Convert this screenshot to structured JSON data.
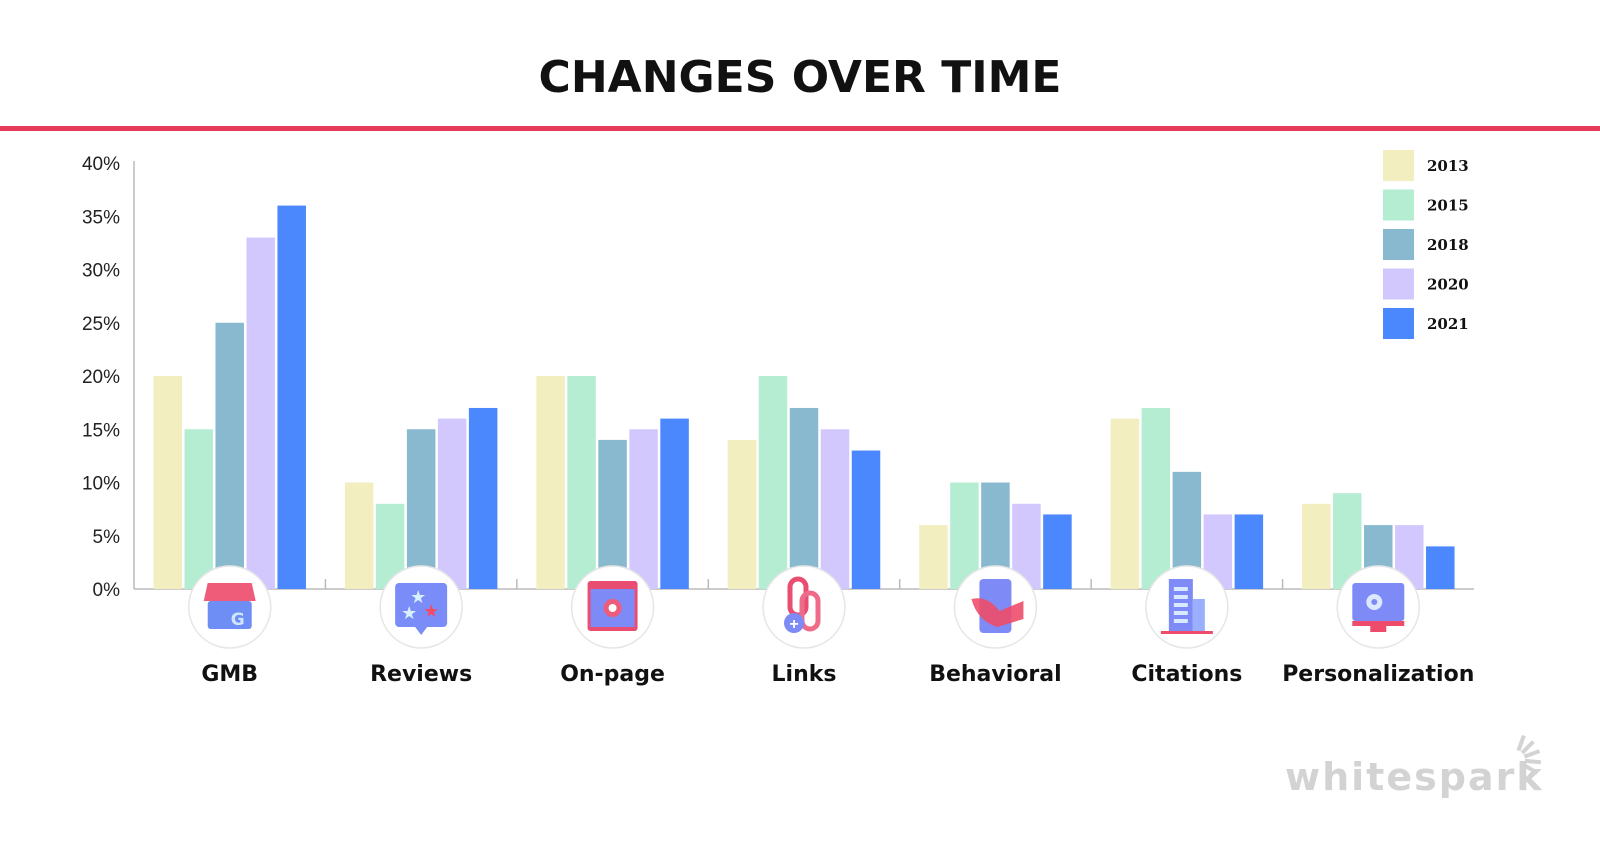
{
  "chart_data": {
    "type": "bar",
    "title": "CHANGES OVER TIME",
    "xlabel": "",
    "ylabel": "",
    "ylim": [
      0,
      40
    ],
    "yticks": [
      "0%",
      "5%",
      "10%",
      "15%",
      "20%",
      "25%",
      "30%",
      "35%",
      "40%"
    ],
    "ytick_values": [
      0,
      5,
      10,
      15,
      20,
      25,
      30,
      35,
      40
    ],
    "grid": false,
    "legend_position": "top-right",
    "categories": [
      "GMB",
      "Reviews",
      "On-page",
      "Links",
      "Behavioral",
      "Citations",
      "Personalization"
    ],
    "category_icons": [
      "storefront-icon",
      "star-review-icon",
      "webpage-gear-icon",
      "link-chain-icon",
      "smartphone-hand-icon",
      "building-icon",
      "monitor-gear-icon"
    ],
    "series": [
      {
        "name": "2013",
        "color": "#f3eec0",
        "values": [
          20,
          10,
          20,
          14,
          6,
          16,
          8
        ]
      },
      {
        "name": "2015",
        "color": "#b5edd3",
        "values": [
          15,
          8,
          20,
          20,
          10,
          17,
          9
        ]
      },
      {
        "name": "2018",
        "color": "#89b9cf",
        "values": [
          25,
          15,
          14,
          17,
          10,
          11,
          6
        ]
      },
      {
        "name": "2020",
        "color": "#d3c8fd",
        "values": [
          33,
          16,
          15,
          15,
          8,
          7,
          6
        ]
      },
      {
        "name": "2021",
        "color": "#4b87fd",
        "values": [
          36,
          17,
          16,
          13,
          7,
          7,
          4
        ]
      }
    ]
  },
  "accent_color": "#e53a5a",
  "brand": "whitespark"
}
